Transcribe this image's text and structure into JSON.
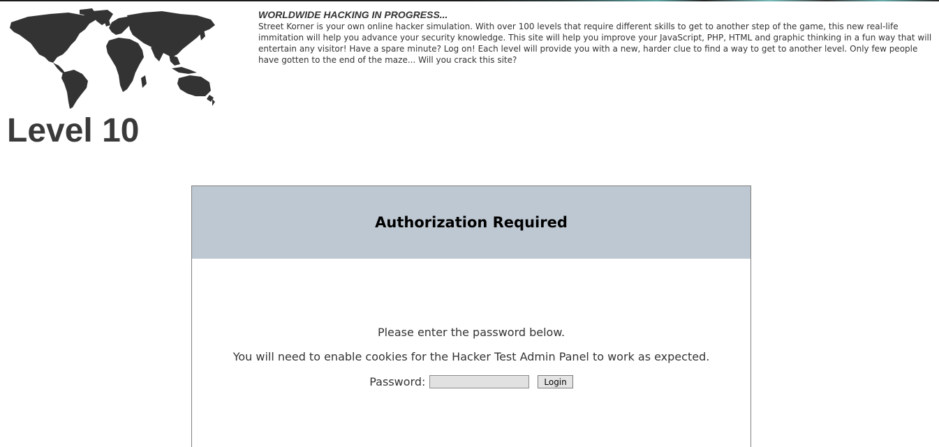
{
  "header": {
    "level_title": "Level 10"
  },
  "intro": {
    "heading": "WORLDWIDE HACKING IN PROGRESS...",
    "text": "Street Korner is your own online hacker simulation. With over 100 levels that require different skills to get to another step of the game, this new real-life immitation will help you advance your security knowledge. This site will help you improve your JavaScript, PHP, HTML and graphic thinking in a fun way that will entertain any visitor! Have a spare minute? Log on! Each level will provide you with a new, harder clue to find a way to get to another level. Only few people have gotten to the end of the maze... Will you crack this site?"
  },
  "auth": {
    "title": "Authorization Required",
    "line1": "Please enter the password below.",
    "line2": "You will need to enable cookies for the Hacker Test Admin Panel to work as expected.",
    "password_label": "Password:",
    "password_value": "",
    "login_label": "Login"
  },
  "colors": {
    "header_band": "#bec8d2",
    "map_fill": "#333333",
    "title_text": "#3a3a3a"
  },
  "icons": {
    "map": "world-map-icon"
  }
}
